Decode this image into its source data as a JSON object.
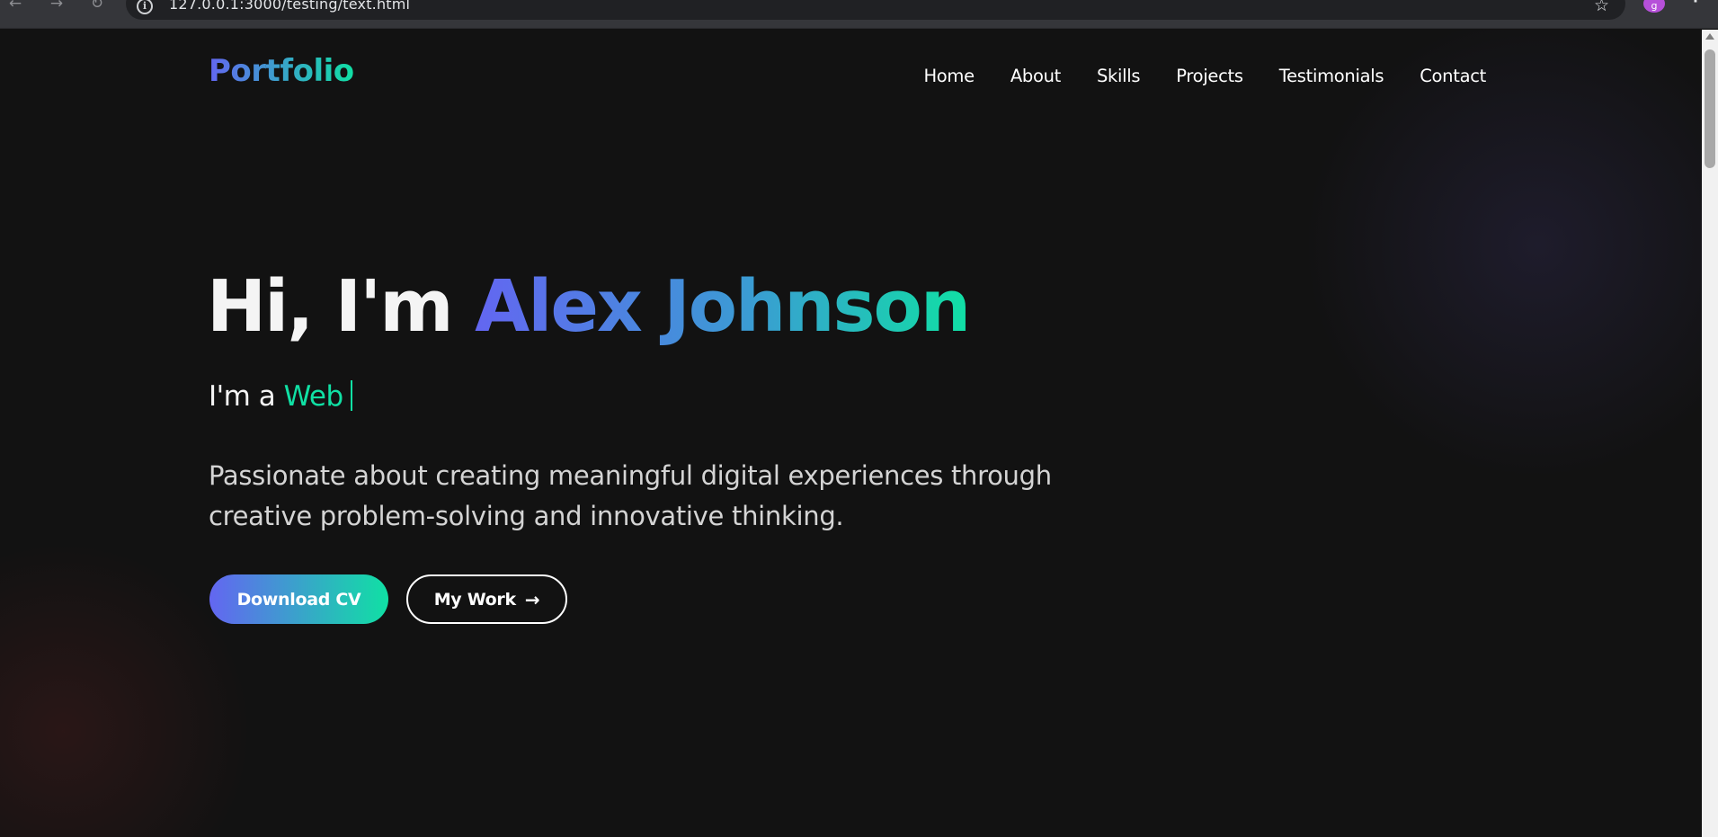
{
  "browser": {
    "url": "127.0.0.1:3000/testing/text.html",
    "profile_initial": "g"
  },
  "header": {
    "logo": "Portfolio",
    "nav": [
      "Home",
      "About",
      "Skills",
      "Projects",
      "Testimonials",
      "Contact"
    ]
  },
  "hero": {
    "greeting": "Hi, I'm ",
    "name": "Alex Johnson",
    "role_prefix": "I'm a ",
    "role_typed": "Web",
    "description": "Passionate about creating meaningful digital experiences through creative problem-solving and innovative thinking.",
    "primary_button": "Download CV",
    "secondary_button": "My Work"
  },
  "colors": {
    "background": "#121212",
    "gradient_start": "#6366f1",
    "gradient_end": "#10e0a4",
    "accent": "#10e0a4"
  },
  "icons": [
    "info-icon",
    "star-icon",
    "arrow-right-icon",
    "back-icon",
    "forward-icon",
    "reload-icon",
    "menu-dots-icon"
  ]
}
